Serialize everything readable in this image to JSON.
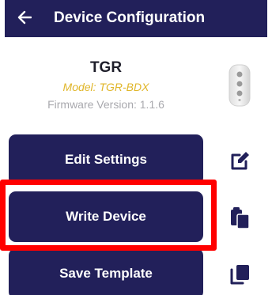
{
  "header": {
    "title": "Device Configuration",
    "back_icon": "arrow-left-icon",
    "background": "#22205a"
  },
  "device": {
    "name": "TGR",
    "model": "Model: TGR-BDX",
    "firmware": "Firmware Version: 1.1.6",
    "image_icon": "device-thumbnail"
  },
  "actions": {
    "edit_label": "Edit Settings",
    "edit_icon": "pencil-square-icon",
    "write_label": "Write Device",
    "write_icon": "clipboard-icon",
    "save_label": "Save Template",
    "save_icon": "copy-icon"
  },
  "colors": {
    "primary": "#22205a",
    "model_text": "#e0b62a",
    "firmware_text": "#a9a9ae",
    "highlight": "#ff0000"
  }
}
